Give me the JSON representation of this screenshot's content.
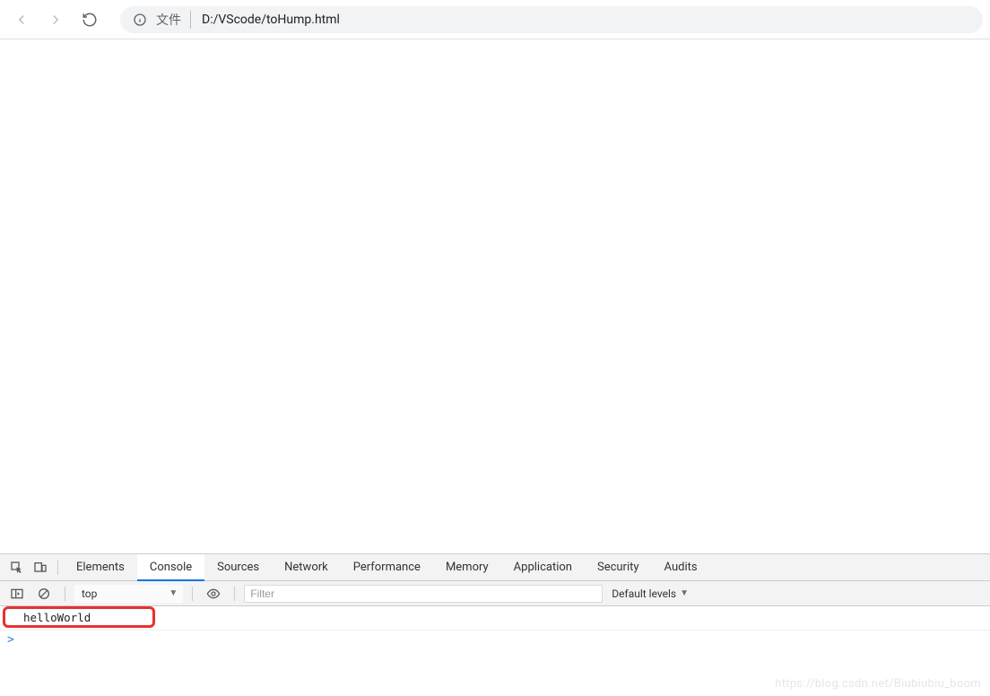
{
  "toolbar": {
    "file_label": "文件",
    "url_path": "D:/VScode/toHump.html"
  },
  "devtools": {
    "tabs": [
      "Elements",
      "Console",
      "Sources",
      "Network",
      "Performance",
      "Memory",
      "Application",
      "Security",
      "Audits"
    ],
    "active_tab": "Console",
    "context": "top",
    "filter_placeholder": "Filter",
    "levels_label": "Default levels"
  },
  "console": {
    "log_output": "helloWorld",
    "prompt": ">"
  },
  "watermark": "https://blog.csdn.net/Biubiubiu_boom"
}
